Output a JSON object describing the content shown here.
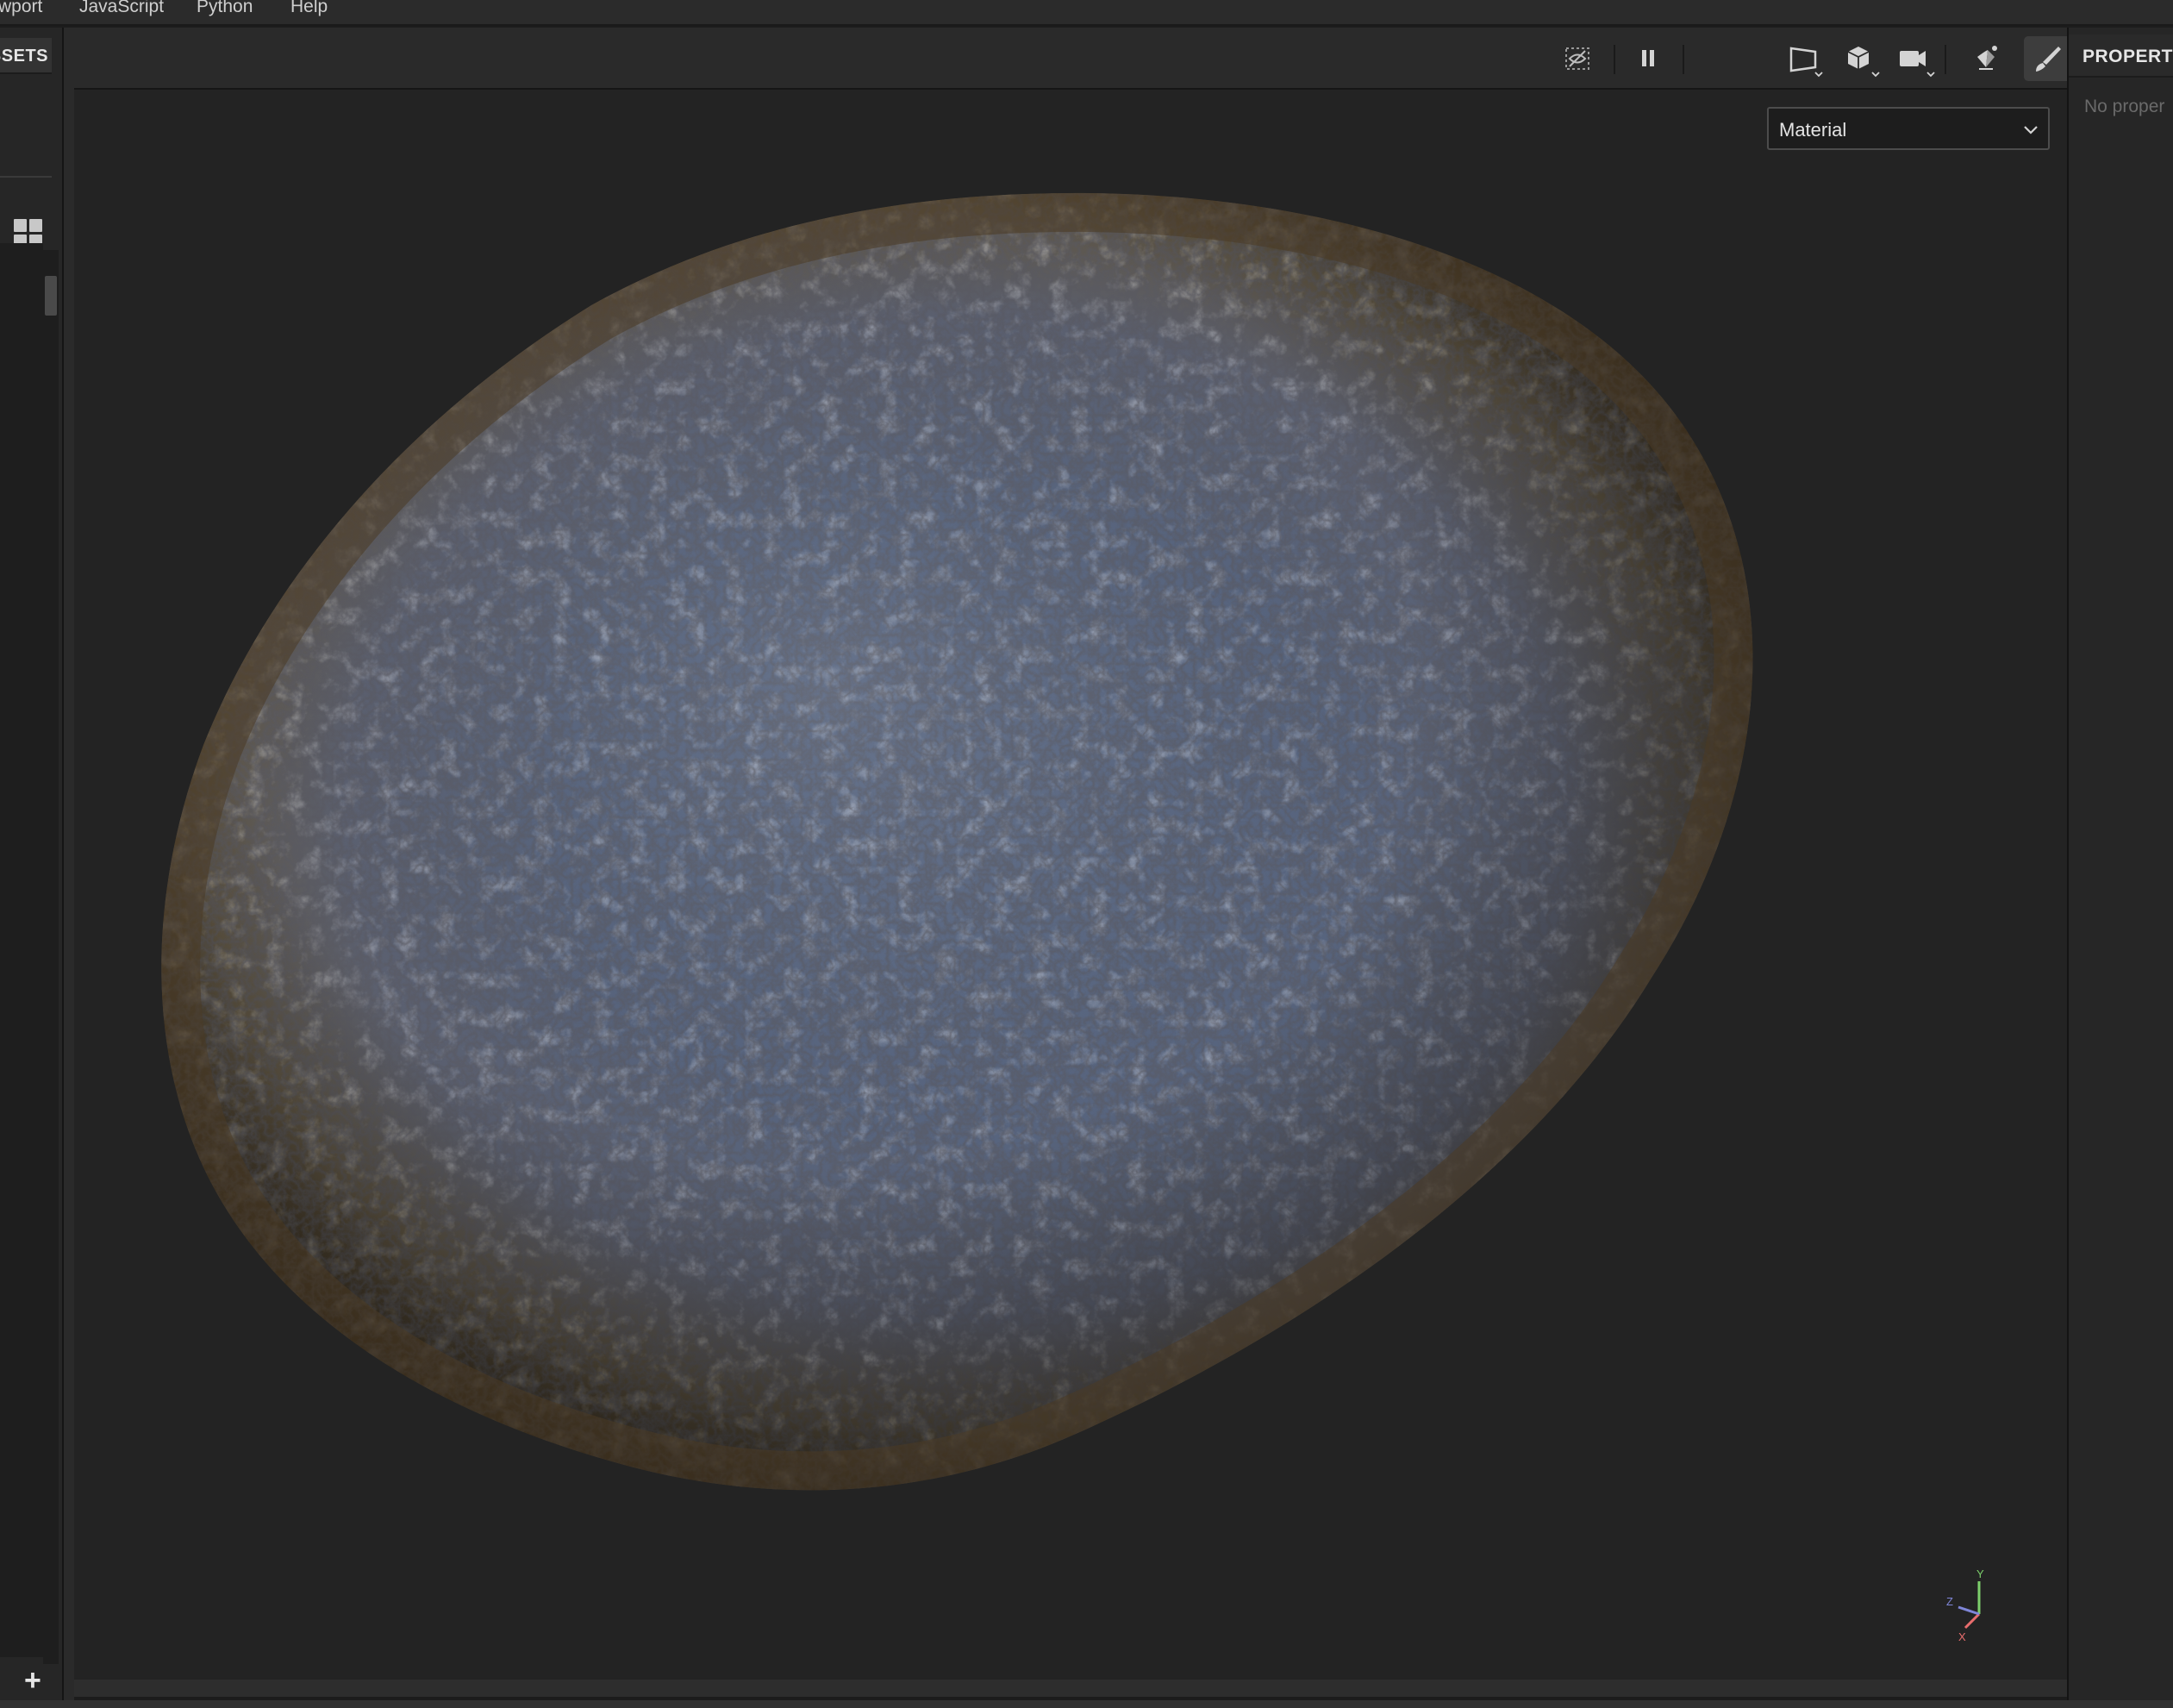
{
  "menu": {
    "items": [
      {
        "label": "wport"
      },
      {
        "label": "JavaScript"
      },
      {
        "label": "Python"
      },
      {
        "label": "Help"
      }
    ]
  },
  "assets_panel": {
    "title": "SSETS",
    "grid_icon": "grid-view-icon",
    "add_label": "+"
  },
  "viewport": {
    "shading_mode": {
      "selected": "Material"
    },
    "toolbar": {
      "icons": [
        "hide-icon",
        "pause-icon",
        "perspective-icon",
        "cube-icon",
        "camera-icon",
        "lighting-icon",
        "paint-brush-icon",
        "screenshot-icon"
      ]
    },
    "axes": {
      "x": "X",
      "y": "Y",
      "z": "Z"
    },
    "colors": {
      "axis_x": "#e86d6d",
      "axis_y": "#7ccf6b",
      "axis_z": "#7f86d8"
    }
  },
  "properties_panel": {
    "title": "PROPERTI",
    "empty_text": "No proper"
  }
}
